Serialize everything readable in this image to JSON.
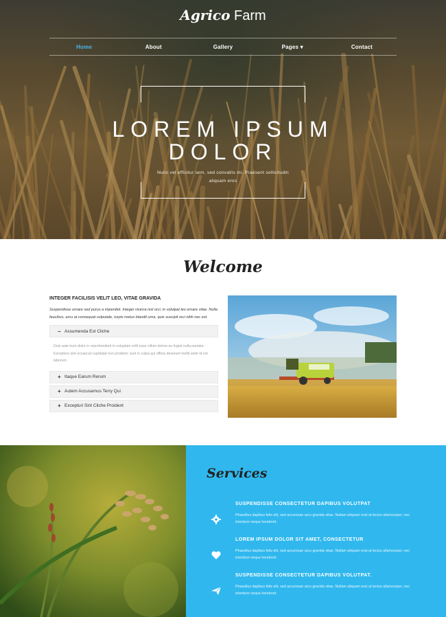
{
  "brand": {
    "logo_bold": "Agrico",
    "logo_light": "Farm"
  },
  "nav": [
    "Home",
    "About",
    "Gallery",
    "Pages ▾",
    "Contact"
  ],
  "hero": {
    "title_line1": "LOREM IPSUM",
    "title_line2": "DOLOR",
    "subtitle": "Nunc vel efficitur sem, sed convallis mi. Praesent sollicitudin aliquam eros"
  },
  "welcome": {
    "title": "Welcome",
    "heading": "INTEGER FACILISIS VELIT LEO, VITAE GRAVIDA",
    "intro": "Suspendisse ornare sed purus a imperdiet. Integer viverra nisl orci, in volutpat leo ornare vitae. Nulla faucibus, arcu at consequat vulputate, turpis metus blandit urna, quis suscipit orci nibh nec est.",
    "accordion": [
      {
        "label": "Assumenda Est Cliche",
        "symbol": "−",
        "open": true,
        "body": "Duis aute irure dolor in reprehenderit in voluptate velit esse cillum dolore eu fugiat nulla pariatur. Excepteur sint occaecat cupidatat non proident, sunt in culpa qui officia deserunt mollit anim id est laborum."
      },
      {
        "label": "Itaque Earum Rerum",
        "symbol": "+"
      },
      {
        "label": "Autem Accusamus Terry Qui",
        "symbol": "+"
      },
      {
        "label": "Excepturi Sint Cliche Proident",
        "symbol": "+"
      }
    ]
  },
  "services": {
    "title": "Services",
    "items": [
      {
        "icon": "gear-icon",
        "heading": "SUSPENDISSE CONSECTETUR DAPIBUS VOLUTPAT",
        "text": "Phasellus dapibus felis elit, sed accumsan arcu gravida vitae. Nullam aliquam erat at lectus ullamcorper, nec interdum neque hendrerit."
      },
      {
        "icon": "heart-icon",
        "heading": "LOREM IPSUM DOLOR SIT AMET, CONSECTETUR",
        "text": "Phasellus dapibus felis elit, sed accumsan arcu gravida vitae. Nullam aliquam erat at lectus ullamcorper, nec interdum neque hendrerit."
      },
      {
        "icon": "paper-plane-icon",
        "heading": "SUSPENDISSE CONSECTETUR DAPIBUS VOLUTPAT.",
        "text": "Phasellus dapibus felis elit, sed accumsan arcu gravida vitae. Nullam aliquam erat at lectus ullamcorper, nec interdum neque hendrerit."
      }
    ]
  },
  "colors": {
    "accent": "#30b8ee",
    "nav_active": "#4ab6ec"
  }
}
